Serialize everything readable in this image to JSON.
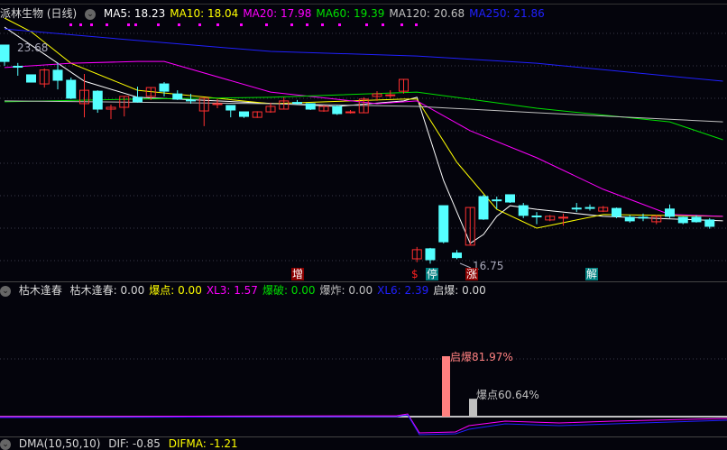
{
  "header": {
    "stock_title": "派林生物 (日线)",
    "ma": [
      {
        "label": "MA5: 18.23",
        "color": "#ffffff"
      },
      {
        "label": "MA10: 18.04",
        "color": "#ffff00"
      },
      {
        "label": "MA20: 17.98",
        "color": "#ff00ff"
      },
      {
        "label": "MA60: 19.39",
        "color": "#00e000"
      },
      {
        "label": "MA120: 20.68",
        "color": "#c0c0c0"
      },
      {
        "label": "MA250: 21.86",
        "color": "#2020ff"
      }
    ]
  },
  "price_panel": {
    "high_label": "23.68",
    "low_label": "16.75",
    "markers": [
      {
        "text": "增",
        "bg": "#8b0000",
        "fg": "#ffffff"
      },
      {
        "text": "$",
        "bg": "transparent",
        "fg": "#ff2020"
      },
      {
        "text": "停",
        "bg": "#008080",
        "fg": "#ffffff"
      },
      {
        "text": "涨",
        "bg": "#8b0000",
        "fg": "#ffffff"
      },
      {
        "text": "解",
        "bg": "#008080",
        "fg": "#ffffff"
      }
    ]
  },
  "indicator": {
    "name": "枯木逢春",
    "values": [
      {
        "label": "枯木逢春: 0.00",
        "color": "#d8d8d8"
      },
      {
        "label": "爆点: 0.00",
        "color": "#ffff00"
      },
      {
        "label": "XL3: 1.57",
        "color": "#ff00ff"
      },
      {
        "label": "爆破: 0.00",
        "color": "#00e000"
      },
      {
        "label": "爆炸: 0.00",
        "color": "#c0c0c0"
      },
      {
        "label": "XL6: 2.39",
        "color": "#2020ff"
      },
      {
        "label": "启爆: 0.00",
        "color": "#d8d8d8"
      }
    ],
    "bar_labels": {
      "qibao": "启爆81.97%",
      "baodian": "爆点60.64%"
    },
    "bar_values": {
      "qibao": 81.97,
      "baodian": 60.64
    }
  },
  "dma": {
    "name": "DMA(10,50,10)",
    "dif": "DIF: -0.85",
    "difma": "DIFMA: -1.21"
  },
  "colors": {
    "up": "#ff3030",
    "down": "#54ffff",
    "bg": "#04040c"
  },
  "chart_data": {
    "type": "candlestick",
    "ohlc": [
      [
        23.8,
        23.8,
        23.12,
        23.26
      ],
      [
        23.1,
        23.21,
        22.79,
        23.09
      ],
      [
        22.82,
        22.82,
        22.58,
        22.58
      ],
      [
        22.52,
        23.03,
        22.4,
        22.98
      ],
      [
        22.97,
        23.21,
        22.34,
        22.64
      ],
      [
        22.64,
        22.73,
        22.02,
        22.05
      ],
      [
        21.87,
        22.85,
        21.42,
        22.31
      ],
      [
        22.28,
        22.31,
        21.57,
        21.69
      ],
      [
        21.69,
        21.84,
        21.36,
        21.75
      ],
      [
        21.75,
        22.11,
        21.45,
        22.11
      ],
      [
        22.08,
        22.43,
        21.9,
        21.93
      ],
      [
        22.11,
        22.4,
        21.99,
        22.4
      ],
      [
        22.52,
        22.58,
        22.11,
        22.28
      ],
      [
        22.19,
        22.31,
        21.99,
        22.02
      ],
      [
        21.99,
        22.19,
        21.87,
        21.98
      ],
      [
        21.63,
        22.05,
        21.13,
        22.05
      ],
      [
        21.86,
        22.02,
        21.72,
        21.87
      ],
      [
        21.81,
        21.81,
        21.42,
        21.66
      ],
      [
        21.6,
        21.6,
        21.4,
        21.45
      ],
      [
        21.42,
        21.62,
        21.4,
        21.6
      ],
      [
        21.6,
        21.9,
        21.57,
        21.78
      ],
      [
        21.69,
        22.08,
        21.69,
        21.96
      ],
      [
        21.91,
        21.99,
        21.84,
        21.9
      ],
      [
        21.87,
        21.87,
        21.66,
        21.69
      ],
      [
        21.63,
        21.81,
        21.6,
        21.78
      ],
      [
        21.78,
        21.81,
        21.5,
        21.54
      ],
      [
        21.59,
        21.66,
        21.54,
        21.6
      ],
      [
        21.57,
        22.08,
        21.57,
        22.02
      ],
      [
        22.11,
        22.28,
        21.96,
        22.19
      ],
      [
        22.15,
        22.31,
        22.05,
        22.16
      ],
      [
        22.28,
        22.67,
        22.2,
        22.67
      ],
      [
        16.76,
        17.15,
        16.65,
        17.06
      ],
      [
        17.09,
        17.12,
        16.6,
        16.73
      ],
      [
        18.51,
        18.51,
        17.27,
        17.32
      ],
      [
        16.95,
        17.05,
        16.75,
        16.8
      ],
      [
        17.21,
        18.45,
        17.21,
        18.45
      ],
      [
        18.81,
        18.87,
        18.04,
        18.07
      ],
      [
        18.7,
        18.81,
        18.4,
        18.69
      ],
      [
        18.87,
        18.87,
        18.6,
        18.63
      ],
      [
        18.51,
        18.6,
        18.1,
        18.19
      ],
      [
        18.17,
        18.3,
        17.9,
        18.16
      ],
      [
        18.04,
        18.2,
        18.0,
        18.16
      ],
      [
        18.12,
        18.25,
        17.85,
        18.13
      ],
      [
        18.43,
        18.6,
        18.3,
        18.42
      ],
      [
        18.45,
        18.55,
        18.35,
        18.44
      ],
      [
        18.33,
        18.5,
        18.3,
        18.45
      ],
      [
        18.42,
        18.45,
        18.1,
        18.16
      ],
      [
        18.13,
        18.2,
        17.95,
        18.01
      ],
      [
        18.13,
        18.25,
        18.0,
        18.12
      ],
      [
        17.98,
        18.2,
        17.9,
        18.16
      ],
      [
        18.4,
        18.55,
        18.1,
        18.16
      ],
      [
        18.13,
        18.15,
        17.9,
        17.95
      ],
      [
        18.13,
        18.2,
        17.95,
        17.98
      ],
      [
        18.04,
        18.1,
        17.75,
        17.83
      ]
    ],
    "ma_lines": [
      {
        "name": "MA5",
        "color": "#ffffff",
        "points": [
          [
            0,
            24.39
          ],
          [
            6,
            22.61
          ],
          [
            10,
            22.08
          ],
          [
            25,
            21.78
          ],
          [
            30,
            21.96
          ],
          [
            31,
            22.08
          ],
          [
            33,
            19.34
          ],
          [
            35,
            17.27
          ],
          [
            36,
            17.56
          ],
          [
            37,
            18.16
          ],
          [
            38,
            18.51
          ],
          [
            40,
            18.39
          ],
          [
            45,
            18.16
          ],
          [
            54,
            18.01
          ]
        ]
      },
      {
        "name": "MA10",
        "color": "#ffff00",
        "points": [
          [
            0,
            24.69
          ],
          [
            2,
            24.24
          ],
          [
            5,
            23.2
          ],
          [
            10,
            22.31
          ],
          [
            20,
            21.87
          ],
          [
            30,
            22.02
          ],
          [
            31,
            22.02
          ],
          [
            34,
            19.94
          ],
          [
            37,
            18.39
          ],
          [
            40,
            17.77
          ],
          [
            45,
            18.22
          ],
          [
            54,
            18.16
          ]
        ]
      },
      {
        "name": "MA20",
        "color": "#ff00ff",
        "points": [
          [
            0,
            23.06
          ],
          [
            5,
            23.2
          ],
          [
            10,
            23.26
          ],
          [
            12,
            23.26
          ],
          [
            20,
            22.25
          ],
          [
            28,
            21.87
          ],
          [
            31,
            21.96
          ],
          [
            35,
            20.98
          ],
          [
            40,
            20.09
          ],
          [
            45,
            19.05
          ],
          [
            50,
            18.22
          ],
          [
            54,
            18.16
          ]
        ]
      },
      {
        "name": "MA60",
        "color": "#00e000",
        "points": [
          [
            0,
            21.93
          ],
          [
            10,
            22.02
          ],
          [
            20,
            22.08
          ],
          [
            31,
            22.25
          ],
          [
            40,
            21.72
          ],
          [
            50,
            21.27
          ],
          [
            54,
            20.68
          ]
        ]
      },
      {
        "name": "MA120",
        "color": "#c0c0c0",
        "points": [
          [
            0,
            21.96
          ],
          [
            20,
            21.87
          ],
          [
            31,
            21.78
          ],
          [
            40,
            21.57
          ],
          [
            54,
            21.27
          ]
        ]
      },
      {
        "name": "MA250",
        "color": "#2020ff",
        "points": [
          [
            0,
            24.33
          ],
          [
            10,
            23.95
          ],
          [
            20,
            23.59
          ],
          [
            31,
            23.44
          ],
          [
            40,
            23.2
          ],
          [
            54,
            22.61
          ]
        ]
      }
    ]
  }
}
